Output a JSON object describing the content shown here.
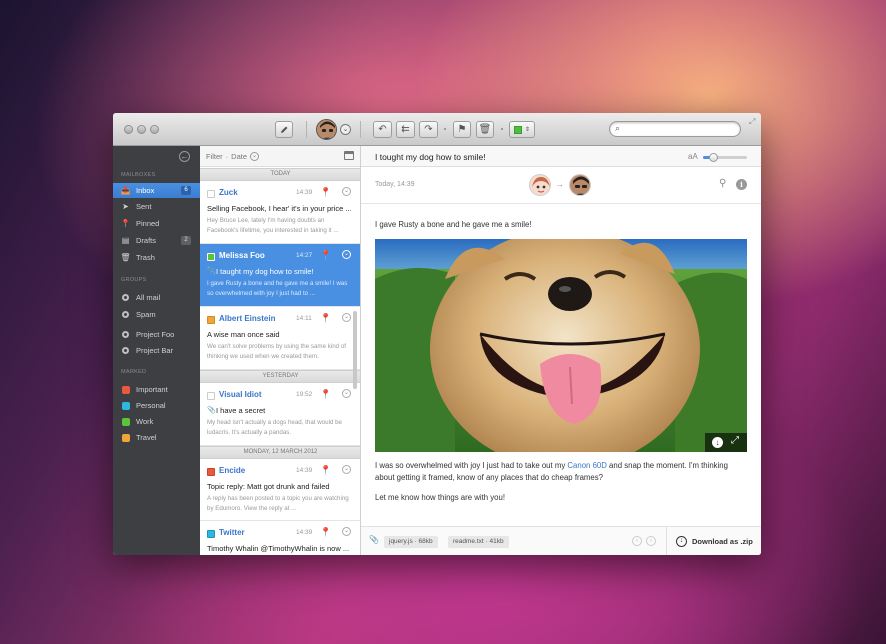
{
  "toolbar": {
    "compose_icon": "pencil-icon",
    "actions": [
      "reply-icon",
      "reply-all-icon",
      "forward-icon",
      "flag-icon",
      "trash-icon",
      "label-color-icon"
    ],
    "label_color": "#4cc13e",
    "search_placeholder": ""
  },
  "sidebar": {
    "mailboxes_heading": "MAILBOXES",
    "mailboxes": [
      {
        "label": "Inbox",
        "badge": "6",
        "icon": "inbox-icon",
        "active": true
      },
      {
        "label": "Sent",
        "badge": "",
        "icon": "send-icon",
        "active": false
      },
      {
        "label": "Pinned",
        "badge": "",
        "icon": "pin-icon",
        "active": false
      },
      {
        "label": "Drafts",
        "badge": "2",
        "icon": "drafts-icon",
        "active": false
      },
      {
        "label": "Trash",
        "badge": "",
        "icon": "trash-icon",
        "active": false
      }
    ],
    "groups_heading": "GROUPS",
    "groups": [
      "All mail",
      "Spam",
      "Project Foo",
      "Project Bar"
    ],
    "marked_heading": "MARKED",
    "marked": [
      {
        "label": "Important",
        "color": "#e8593e"
      },
      {
        "label": "Personal",
        "color": "#2fb6e0"
      },
      {
        "label": "Work",
        "color": "#5cc43a"
      },
      {
        "label": "Travel",
        "color": "#f0a53a"
      }
    ]
  },
  "list": {
    "filter_label": "Filter",
    "filter_value": "Date",
    "sections": {
      "today": "TODAY",
      "yesterday": "YESTERDAY",
      "monday": "MONDAY, 12 MARCH 2012"
    },
    "messages": [
      {
        "from": "Zuck",
        "time": "14:39",
        "subject": "Selling Facebook, I hear' it's in your price ...",
        "preview": "Hey Bruce Lee, lately I'm having doubts an Facebook's lifetime, you interested in taking it ..."
      },
      {
        "from": "Melissa Foo",
        "time": "14:27",
        "subject": "I taught my dog how to smile!",
        "preview": "I gave Rusty a bone and he gave me a smile! I was so overwhelmed with joy I just had to ..."
      },
      {
        "from": "Albert Einstein",
        "time": "14:11",
        "subject": "A wise man once said",
        "preview": "We can't solve problems by using the same kind of thinking we used when we created them."
      },
      {
        "from": "Visual Idiot",
        "time": "19:52",
        "subject": "I have a secret",
        "preview": "My head isn't actually a dogs head, that would be ludacris. It's actually a pandas."
      },
      {
        "from": "Encide",
        "time": "14:39",
        "subject": "Topic reply: Matt got drunk and failed",
        "preview": "A reply has been posted to a topic you are watching by Edumoro. View the reply at ..."
      },
      {
        "from": "Twitter",
        "time": "14:39",
        "subject": "Timothy Whalin @TimothyWhalin is now ...",
        "preview": ""
      }
    ]
  },
  "reading": {
    "subject": "I tought my dog how to smile!",
    "font_size_label": "aA",
    "date": "Today, 14:39",
    "para1": "I gave Rusty a bone and he gave me a smile!",
    "para2_a": "I was so overwhelmed with joy I just had to take out my ",
    "para2_link": "Canon 60D",
    "para2_b": " and snap the moment. I'm thinking about getting it framed, know of any places that do cheap frames?",
    "para3": "Let me know how things are with you!",
    "attachments": [
      {
        "name": "jquery.js",
        "size": "68kb"
      },
      {
        "name": "readme.txt",
        "size": "41kb"
      }
    ],
    "download_label": "Download as .zip"
  }
}
